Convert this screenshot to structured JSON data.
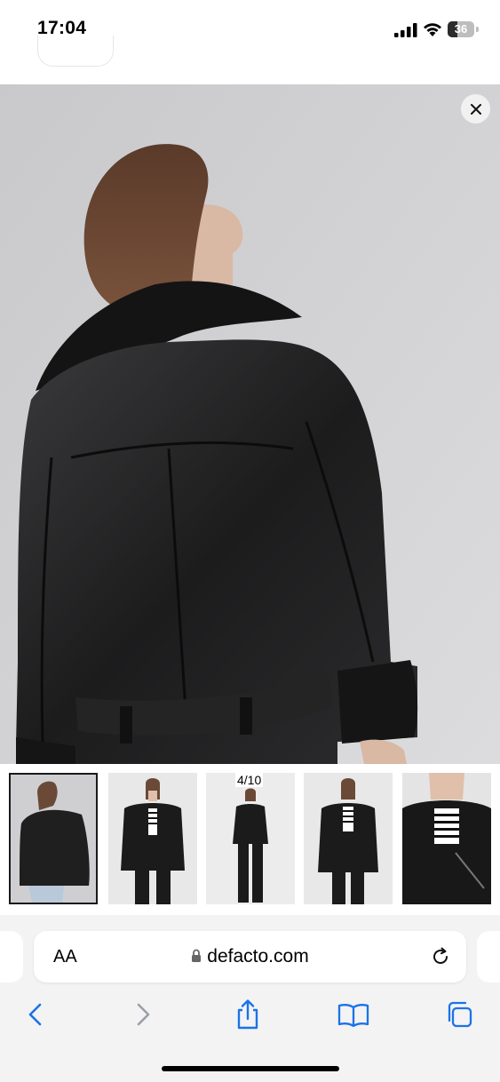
{
  "status_bar": {
    "time": "17:04",
    "battery_level": "36"
  },
  "gallery": {
    "image_alt": "Black faux shearling biker jacket, back view",
    "counter": "4/10",
    "close_icon": "close-icon",
    "thumbnails": [
      {
        "label": "thumbnail-1",
        "active": true
      },
      {
        "label": "thumbnail-2",
        "active": false
      },
      {
        "label": "thumbnail-3",
        "active": false
      },
      {
        "label": "thumbnail-4",
        "active": false
      },
      {
        "label": "thumbnail-5",
        "active": false
      }
    ]
  },
  "safari": {
    "text_size_label": "AA",
    "url": "defacto.com",
    "icons": [
      "lock-icon",
      "reload-icon",
      "back-icon",
      "forward-icon",
      "share-icon",
      "bookmarks-icon",
      "tabs-icon"
    ]
  },
  "colors": {
    "accent": "#1a73e8",
    "disabled": "#9aa0a6",
    "background": "#d3d3d5"
  }
}
